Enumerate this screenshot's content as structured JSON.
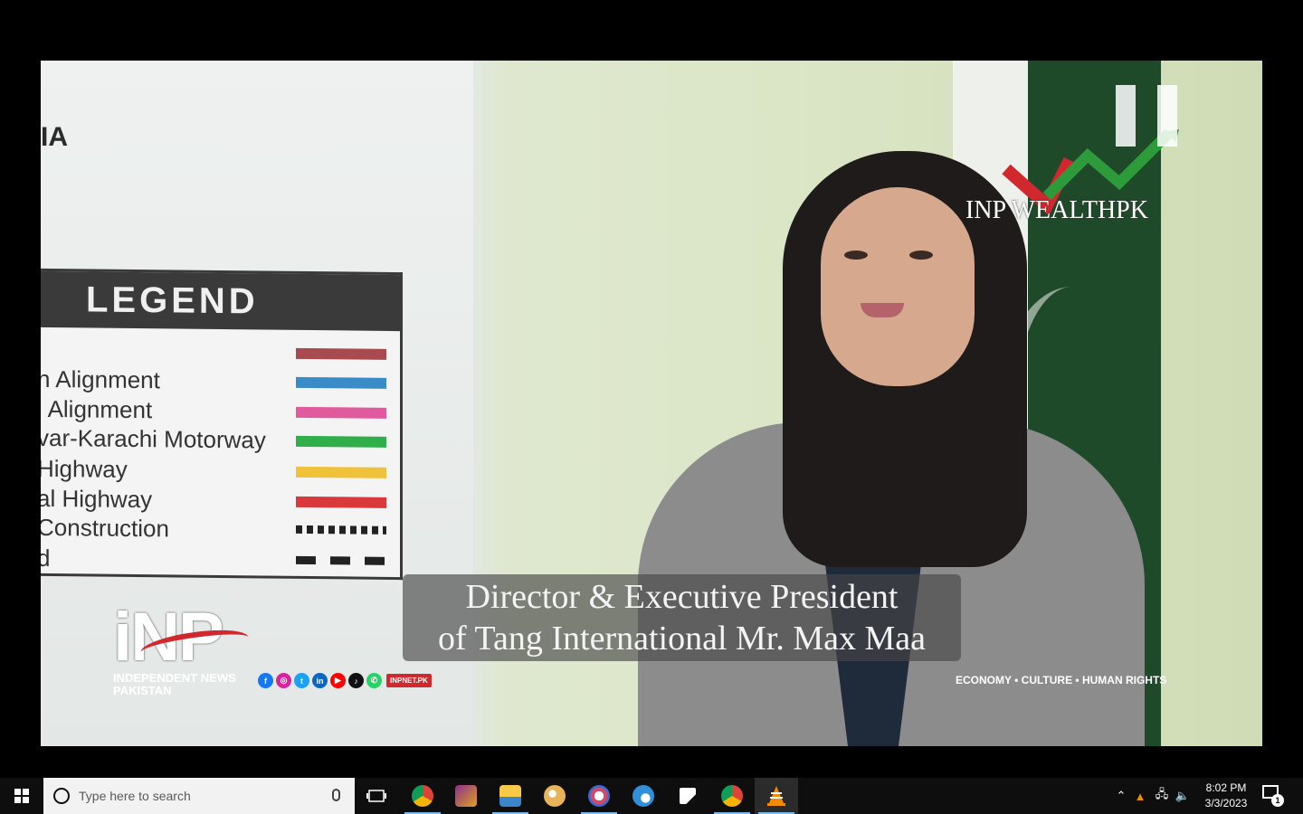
{
  "video": {
    "board_text": "IA",
    "legend": {
      "title": "LEGEND",
      "rows": [
        {
          "label": "",
          "color": "#a84a4f"
        },
        {
          "label": "n Alignment",
          "color": "#3a8cc9"
        },
        {
          "label": "l Alignment",
          "color": "#e25a9e"
        },
        {
          "label": "var-Karachi Motorway",
          "color": "#2fae4a"
        },
        {
          "label": "Highway",
          "color": "#f0c23a"
        },
        {
          "label": "al Highway",
          "color": "#d9393b"
        },
        {
          "label": "Construction",
          "color": "dots"
        },
        {
          "label": "d",
          "color": "dash"
        }
      ]
    },
    "caption_line1": "Director & Executive President",
    "caption_line2": "of Tang International Mr. Max Maa",
    "inp_logo": {
      "big": "iNP",
      "line1": "INDEPENDENT NEWS",
      "line2": "PAKISTAN"
    },
    "social_tag": "INPNET.PK",
    "topics": "ECONOMY  •  CULTURE  •  HUMAN RIGHTS",
    "wealth_logo_text": "INP WEALTHPK"
  },
  "taskbar": {
    "search_placeholder": "Type here to search",
    "apps": [
      "chrome-icon",
      "winrar-icon",
      "file-explorer-icon",
      "paint-icon",
      "snipping-icon",
      "edge-icon",
      "sticky-notes-icon",
      "chrome-profile-icon",
      "vlc-icon"
    ],
    "time": "8:02 PM",
    "date": "3/3/2023",
    "notification_count": "1"
  }
}
